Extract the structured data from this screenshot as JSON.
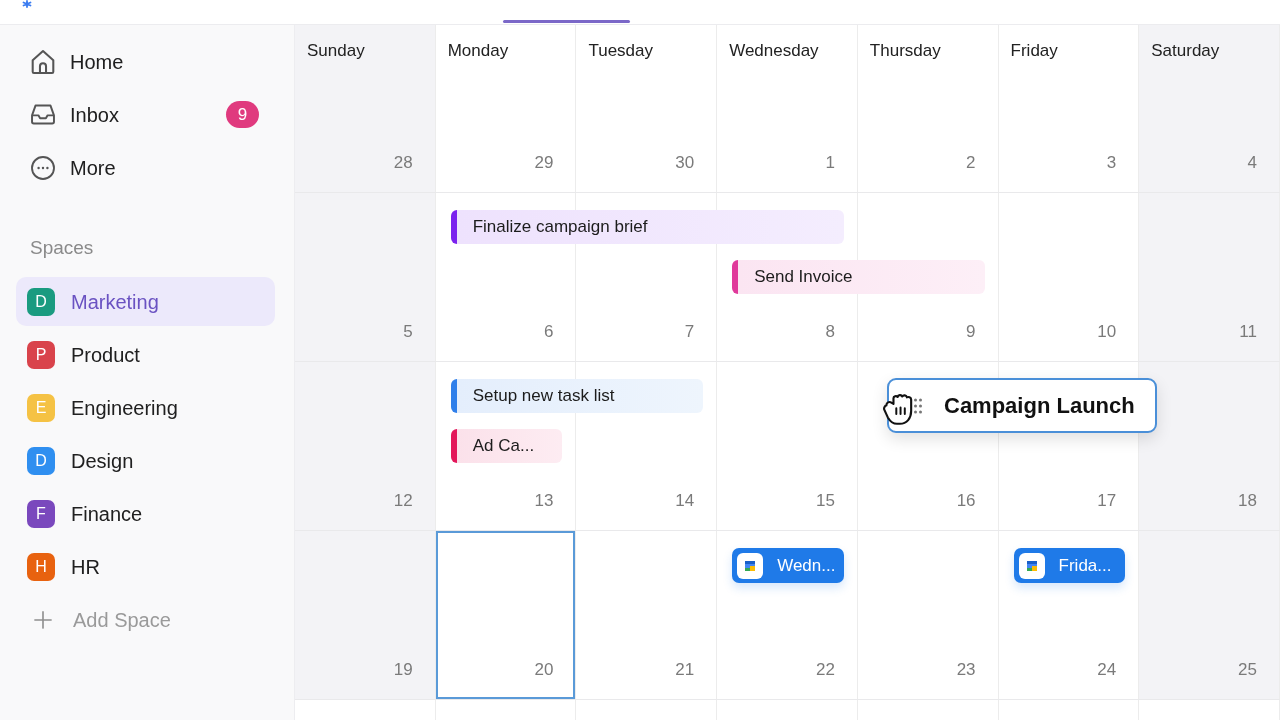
{
  "sidebar": {
    "nav": [
      {
        "kind": "home",
        "label": "Home"
      },
      {
        "kind": "inbox",
        "label": "Inbox",
        "badge": "9"
      },
      {
        "kind": "more",
        "label": "More"
      }
    ],
    "spaces_heading": "Spaces",
    "spaces": [
      {
        "letter": "D",
        "name": "Marketing",
        "color": "#1a9b80",
        "selected": true
      },
      {
        "letter": "P",
        "name": "Product",
        "color": "#d9434b",
        "selected": false
      },
      {
        "letter": "E",
        "name": "Engineering",
        "color": "#f5c244",
        "selected": false
      },
      {
        "letter": "D",
        "name": "Design",
        "color": "#2f8ff0",
        "selected": false
      },
      {
        "letter": "F",
        "name": "Finance",
        "color": "#7a48bd",
        "selected": false
      },
      {
        "letter": "H",
        "name": "HR",
        "color": "#e8620f",
        "selected": false
      }
    ],
    "add_space": "Add Space"
  },
  "calendar": {
    "days": [
      {
        "name": "Sunday",
        "weekend": true
      },
      {
        "name": "Monday",
        "weekend": false
      },
      {
        "name": "Tuesday",
        "weekend": false
      },
      {
        "name": "Wednesday",
        "weekend": false
      },
      {
        "name": "Thursday",
        "weekend": false
      },
      {
        "name": "Friday",
        "weekend": false
      },
      {
        "name": "Saturday",
        "weekend": true
      }
    ],
    "weeks": [
      {
        "cells": [
          {
            "date": "28",
            "selected": false
          },
          {
            "date": "29",
            "selected": false
          },
          {
            "date": "30",
            "selected": false
          },
          {
            "date": "1",
            "selected": false
          },
          {
            "date": "2",
            "selected": false
          },
          {
            "date": "3",
            "selected": false
          },
          {
            "date": "4",
            "selected": false
          }
        ]
      },
      {
        "cells": [
          {
            "date": "5",
            "selected": false
          },
          {
            "date": "6",
            "selected": false,
            "events": [
              {
                "kind": "task",
                "title": "Finalize campaign brief",
                "color": "#7b22ee"
              }
            ]
          },
          {
            "date": "7",
            "selected": false,
            "events": [
              {
                "kind": "middle_day"
              }
            ]
          },
          {
            "date": "8",
            "selected": false,
            "events": [
              {
                "kind": "last_day"
              },
              {
                "kind": "task",
                "title": "Send Invoice",
                "color": "#e0399b"
              }
            ]
          },
          {
            "date": "9",
            "selected": false,
            "events": [
              {
                "kind": "last_day"
              }
            ]
          },
          {
            "date": "10",
            "selected": false
          },
          {
            "date": "11",
            "selected": false
          }
        ]
      },
      {
        "cells": [
          {
            "date": "12",
            "selected": false
          },
          {
            "date": "13",
            "selected": false,
            "events": [
              {
                "kind": "task",
                "title": "Setup new task list",
                "color": "#2f7fea"
              },
              {
                "kind": "task",
                "title": "Ad Ca...",
                "color": "#e3175a"
              }
            ]
          },
          {
            "date": "14",
            "selected": false,
            "events": [
              {
                "kind": "last_day"
              }
            ]
          },
          {
            "date": "15",
            "selected": false
          },
          {
            "date": "16",
            "selected": false
          },
          {
            "date": "17",
            "selected": false
          },
          {
            "date": "18",
            "selected": false
          }
        ]
      },
      {
        "cells": [
          {
            "date": "19",
            "selected": false
          },
          {
            "date": "20",
            "selected": true
          },
          {
            "date": "21",
            "selected": false
          },
          {
            "date": "22",
            "selected": false,
            "events": [
              {
                "kind": "calendar",
                "title": "Wedn...",
                "color": "#1f7ae8"
              }
            ]
          },
          {
            "date": "23",
            "selected": false
          },
          {
            "date": "24",
            "selected": false,
            "events": [
              {
                "kind": "calendar",
                "title": "Frida...",
                "color": "#1f7ae8"
              }
            ]
          },
          {
            "date": "25",
            "selected": false
          }
        ]
      }
    ],
    "dragged_event": {
      "title": "Campaign Launch"
    }
  }
}
